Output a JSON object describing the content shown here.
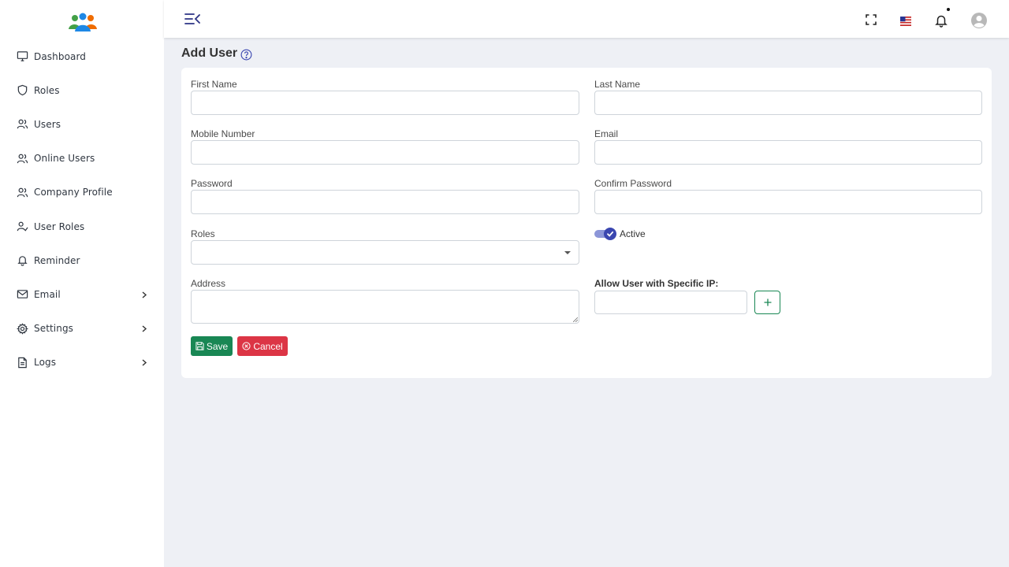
{
  "sidebar": {
    "items": [
      {
        "label": "Dashboard",
        "icon": "monitor-icon"
      },
      {
        "label": "Roles",
        "icon": "shield-icon"
      },
      {
        "label": "Users",
        "icon": "users-icon"
      },
      {
        "label": "Online Users",
        "icon": "users-icon"
      },
      {
        "label": "Company Profile",
        "icon": "users-icon"
      },
      {
        "label": "User Roles",
        "icon": "user-check-icon"
      },
      {
        "label": "Reminder",
        "icon": "bell-icon"
      },
      {
        "label": "Email",
        "icon": "mail-icon",
        "has_submenu": true
      },
      {
        "label": "Settings",
        "icon": "gear-icon",
        "has_submenu": true
      },
      {
        "label": "Logs",
        "icon": "file-icon",
        "has_submenu": true
      }
    ]
  },
  "topbar": {
    "icons": [
      "menu-collapse-icon",
      "fullscreen-icon",
      "us-flag-icon",
      "bell-icon",
      "avatar-icon"
    ],
    "notification_dot": true
  },
  "page": {
    "title": "Add User"
  },
  "form": {
    "first_name": {
      "label": "First Name",
      "value": ""
    },
    "last_name": {
      "label": "Last Name",
      "value": ""
    },
    "mobile": {
      "label": "Mobile Number",
      "value": ""
    },
    "email": {
      "label": "Email",
      "value": ""
    },
    "password": {
      "label": "Password",
      "value": ""
    },
    "confirm_password": {
      "label": "Confirm Password",
      "value": ""
    },
    "roles": {
      "label": "Roles",
      "value": ""
    },
    "active": {
      "label": "Active",
      "checked": true
    },
    "address": {
      "label": "Address",
      "value": ""
    },
    "allow_ip": {
      "label": "Allow User with Specific IP:",
      "value": ""
    },
    "save_label": "Save",
    "cancel_label": "Cancel"
  },
  "colors": {
    "primary": "#3a46b0",
    "toggle_track": "#8c96d8",
    "save": "#198754",
    "cancel": "#dc3545",
    "background": "#eef0f5"
  }
}
